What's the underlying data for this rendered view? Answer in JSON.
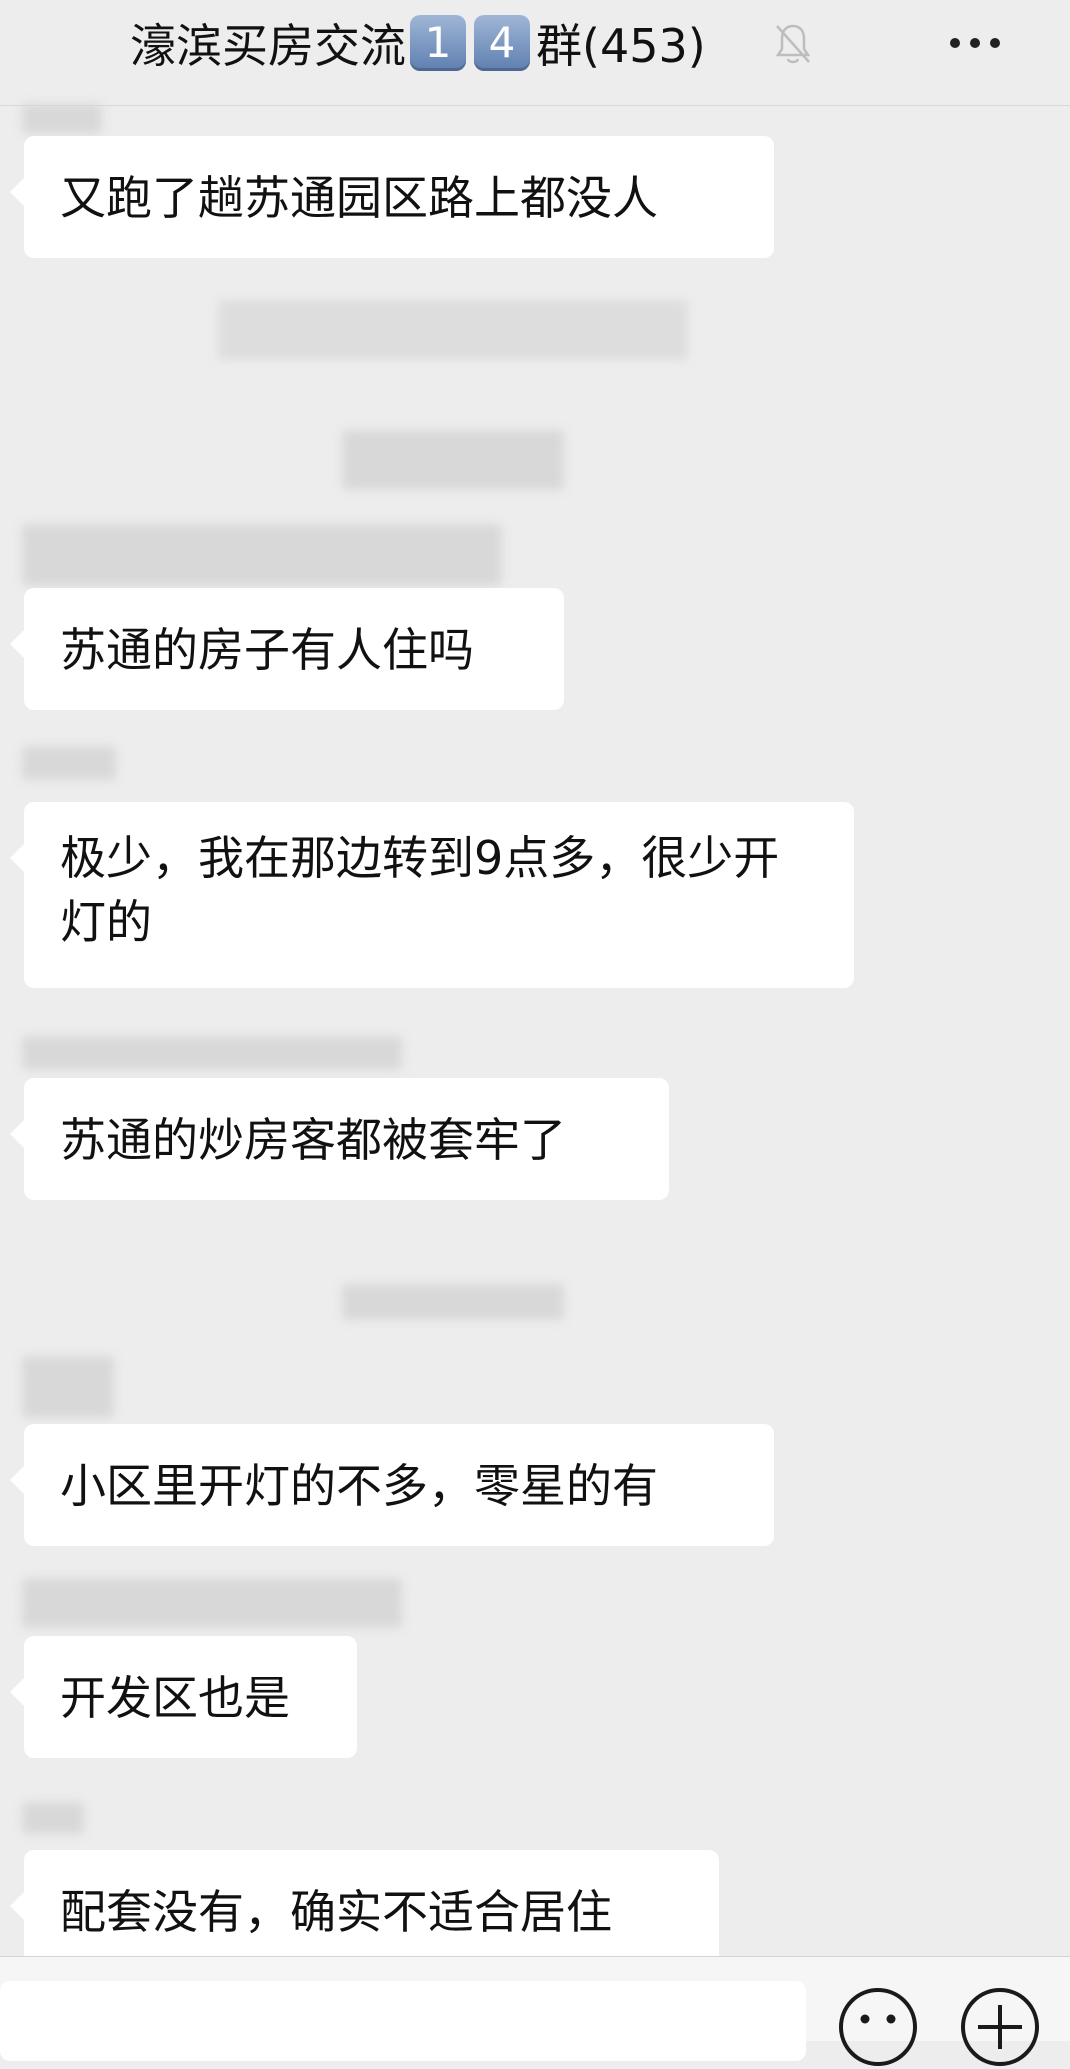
{
  "header": {
    "title": "濠滨买房交流",
    "badges": [
      "1",
      "4"
    ],
    "title_tail": "群(453)",
    "mute_icon": "bell-slash-icon",
    "more_icon": "more-dots-icon"
  },
  "messages": [
    {
      "text": "又跑了趟苏通园区路上都没人"
    },
    {
      "text": "苏通的房子有人住吗"
    },
    {
      "text": "极少，我在那边转到9点多，很少开灯的"
    },
    {
      "text": "苏通的炒房客都被套牢了"
    },
    {
      "text": "小区里开灯的不多，零星的有"
    },
    {
      "text": "开发区也是"
    },
    {
      "text": "配套没有，确实不适合居住"
    }
  ],
  "input_bar": {
    "emoji_icon": "emoji-face-icon",
    "plus_icon": "plus-circle-icon"
  },
  "colors": {
    "background": "#ededed",
    "bubble": "#ffffff",
    "text": "#111111",
    "badge": "#7f9cc6"
  }
}
